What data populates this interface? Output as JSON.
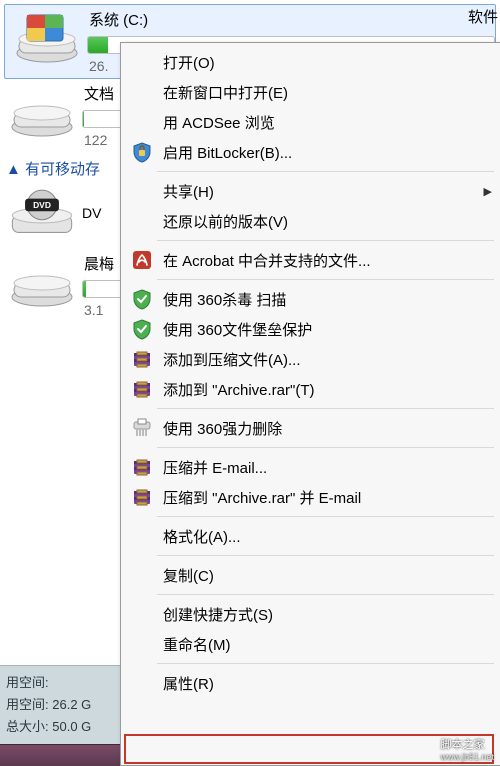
{
  "drives": {
    "c": {
      "title": "系统 (C:)",
      "sub": "26."
    },
    "right_label": "软件",
    "docs": {
      "title": "文档",
      "sub": "122"
    },
    "chen": {
      "title": "晨梅",
      "sub": "3.1"
    }
  },
  "removable_header": "▲ 有可移动存",
  "dvd_label": "DV",
  "info_panel": {
    "row1": {
      "k": "用空间:",
      "v": ""
    },
    "row2": {
      "k": "用空间:",
      "v": "26.2 G"
    },
    "row3": {
      "k": "总大小:",
      "v": "50.0 G"
    }
  },
  "menu": [
    {
      "label": "打开(O)"
    },
    {
      "label": "在新窗口中打开(E)"
    },
    {
      "label": "用 ACDSee 浏览"
    },
    {
      "icon": "bitlocker",
      "label": "启用 BitLocker(B)..."
    },
    {
      "sep": true
    },
    {
      "label": "共享(H)",
      "submenu": true
    },
    {
      "label": "还原以前的版本(V)"
    },
    {
      "sep": true
    },
    {
      "icon": "acrobat",
      "label": "在 Acrobat 中合并支持的文件..."
    },
    {
      "sep": true
    },
    {
      "icon": "shield360",
      "label": "使用 360杀毒 扫描"
    },
    {
      "icon": "shield360",
      "label": "使用 360文件堡垒保护"
    },
    {
      "icon": "winrar",
      "label": "添加到压缩文件(A)..."
    },
    {
      "icon": "winrar",
      "label": "添加到 \"Archive.rar\"(T)"
    },
    {
      "sep": true
    },
    {
      "icon": "shredder",
      "label": "使用 360强力删除"
    },
    {
      "sep": true
    },
    {
      "icon": "winrar",
      "label": "压缩并 E-mail..."
    },
    {
      "icon": "winrar",
      "label": "压缩到 \"Archive.rar\" 并 E-mail"
    },
    {
      "sep": true
    },
    {
      "label": "格式化(A)..."
    },
    {
      "sep": true
    },
    {
      "label": "复制(C)"
    },
    {
      "sep": true
    },
    {
      "label": "创建快捷方式(S)"
    },
    {
      "label": "重命名(M)"
    },
    {
      "sep": true
    },
    {
      "label": "属性(R)"
    }
  ],
  "watermark": {
    "line1": "脚本之家",
    "line2": "www.jb51.net"
  }
}
